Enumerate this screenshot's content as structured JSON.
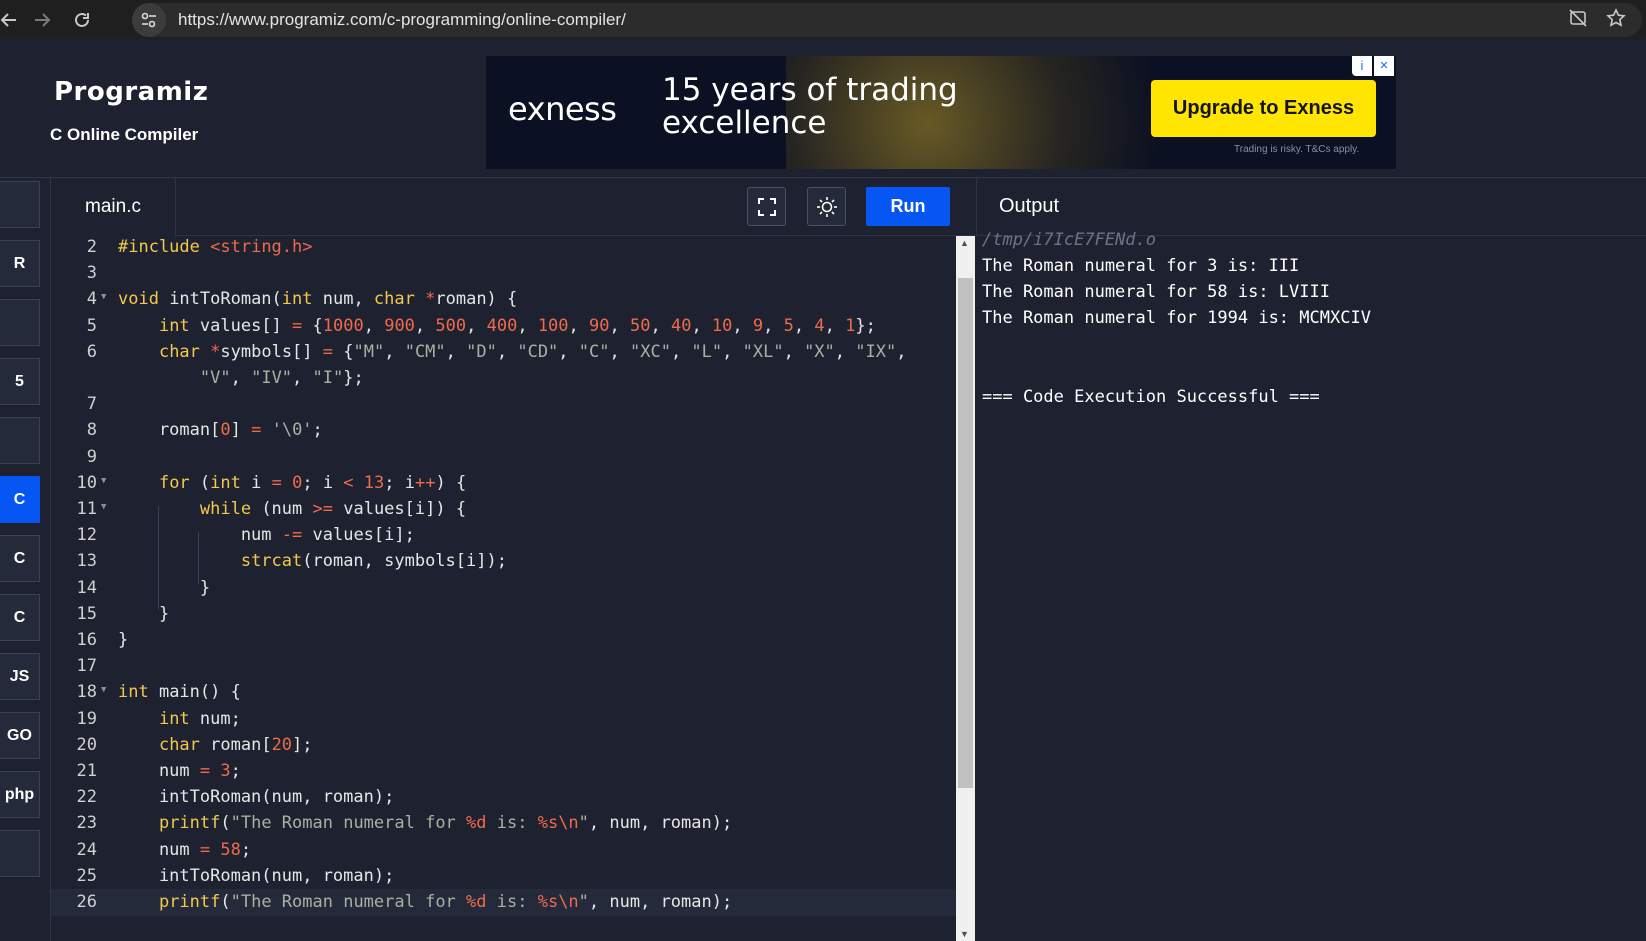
{
  "browser": {
    "url": "https://www.programiz.com/c-programming/online-compiler/"
  },
  "header": {
    "logo_text": "Programiz",
    "subtitle": "C Online Compiler"
  },
  "ad": {
    "brand": "exness",
    "headline": "15 years of trading excellence",
    "cta": "Upgrade to Exness",
    "disclaimer": "Trading is risky. T&Cs apply."
  },
  "sidebar": {
    "languages": [
      {
        "name": "python-icon",
        "label": "",
        "active": false
      },
      {
        "name": "r-icon",
        "label": "R",
        "active": false
      },
      {
        "name": "sql-icon",
        "label": "",
        "active": false
      },
      {
        "name": "html-icon",
        "label": "5",
        "active": false
      },
      {
        "name": "java-icon",
        "label": "",
        "active": false
      },
      {
        "name": "c-icon",
        "label": "C",
        "active": true
      },
      {
        "name": "cpp-icon",
        "label": "C",
        "active": false
      },
      {
        "name": "csharp-icon",
        "label": "C",
        "active": false
      },
      {
        "name": "javascript-icon",
        "label": "JS",
        "active": false
      },
      {
        "name": "go-icon",
        "label": "GO",
        "active": false
      },
      {
        "name": "php-icon",
        "label": "php",
        "active": false
      },
      {
        "name": "swift-icon",
        "label": "",
        "active": false
      }
    ]
  },
  "editor": {
    "file_tab": "main.c",
    "run_label": "Run",
    "lines": [
      {
        "no": "2",
        "code": "#include <string.h>"
      },
      {
        "no": "3",
        "code": ""
      },
      {
        "no": "4",
        "code": "void intToRoman(int num, char *roman) {"
      },
      {
        "no": "5",
        "code": "    int values[] = {1000, 900, 500, 400, 100, 90, 50, 40, 10, 9, 5, 4, 1};"
      },
      {
        "no": "6",
        "code": "    char *symbols[] = {\"M\", \"CM\", \"D\", \"CD\", \"C\", \"XC\", \"L\", \"XL\", \"X\", \"IX\","
      },
      {
        "no": "",
        "code": "        \"V\", \"IV\", \"I\"};"
      },
      {
        "no": "7",
        "code": ""
      },
      {
        "no": "8",
        "code": "    roman[0] = '\\0';"
      },
      {
        "no": "9",
        "code": ""
      },
      {
        "no": "10",
        "code": "    for (int i = 0; i < 13; i++) {"
      },
      {
        "no": "11",
        "code": "        while (num >= values[i]) {"
      },
      {
        "no": "12",
        "code": "            num -= values[i];"
      },
      {
        "no": "13",
        "code": "            strcat(roman, symbols[i]);"
      },
      {
        "no": "14",
        "code": "        }"
      },
      {
        "no": "15",
        "code": "    }"
      },
      {
        "no": "16",
        "code": "}"
      },
      {
        "no": "17",
        "code": ""
      },
      {
        "no": "18",
        "code": "int main() {"
      },
      {
        "no": "19",
        "code": "    int num;"
      },
      {
        "no": "20",
        "code": "    char roman[20];"
      },
      {
        "no": "21",
        "code": "    num = 3;"
      },
      {
        "no": "22",
        "code": "    intToRoman(num, roman);"
      },
      {
        "no": "23",
        "code": "    printf(\"The Roman numeral for %d is: %s\\n\", num, roman);"
      },
      {
        "no": "24",
        "code": "    num = 58;"
      },
      {
        "no": "25",
        "code": "    intToRoman(num, roman);"
      },
      {
        "no": "26",
        "code": "    printf(\"The Roman numeral for %d is: %s\\n\", num, roman);"
      }
    ]
  },
  "output": {
    "title": "Output",
    "path": "/tmp/i7IcE7FENd.o",
    "lines": [
      "The Roman numeral for 3 is: III",
      "The Roman numeral for 58 is: LVIII",
      "The Roman numeral for 1994 is: MCMXCIV",
      "",
      "",
      "=== Code Execution Successful ==="
    ]
  }
}
